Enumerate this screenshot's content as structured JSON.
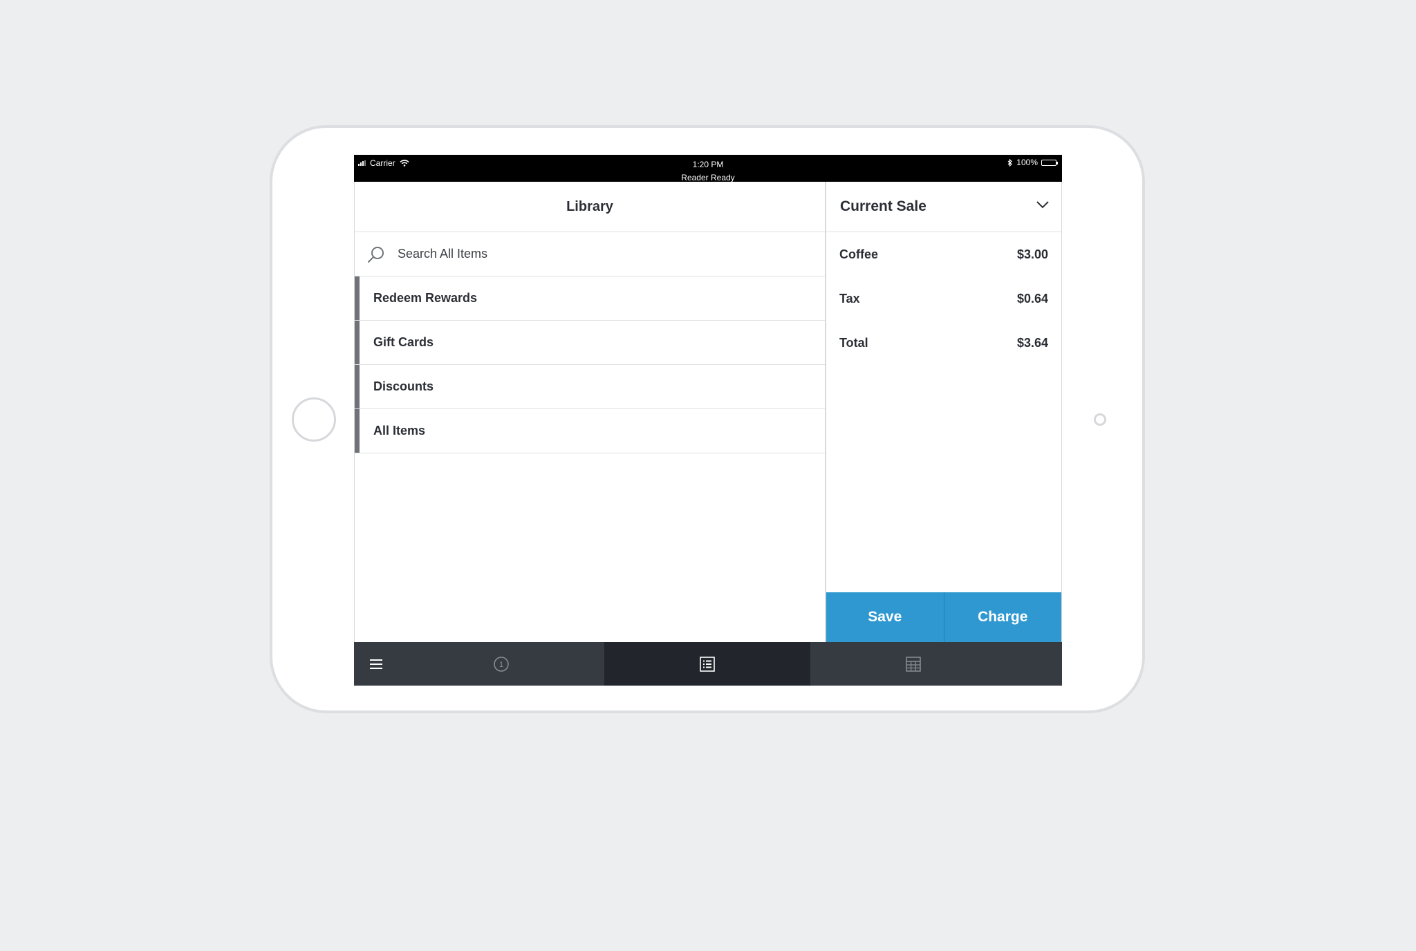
{
  "status_bar": {
    "carrier": "Carrier",
    "time": "1:20 PM",
    "reader_status": "Reader Ready",
    "battery": "100%"
  },
  "library": {
    "title": "Library",
    "search_placeholder": "Search All Items",
    "items": [
      {
        "label": "Redeem Rewards"
      },
      {
        "label": "Gift Cards"
      },
      {
        "label": "Discounts"
      },
      {
        "label": "All Items"
      }
    ]
  },
  "current_sale": {
    "title": "Current Sale",
    "lines": [
      {
        "label": "Coffee",
        "amount": "$3.00"
      },
      {
        "label": "Tax",
        "amount": "$0.64"
      },
      {
        "label": "Total",
        "amount": "$3.64"
      }
    ],
    "save_label": "Save",
    "charge_label": "Charge"
  },
  "tab_bar": {
    "orders_badge": "1",
    "active_tab": "library"
  },
  "colors": {
    "accent": "#2f98d0",
    "tab_bar": "#363b42",
    "tab_active": "#22262c",
    "background": "#edeef0"
  }
}
